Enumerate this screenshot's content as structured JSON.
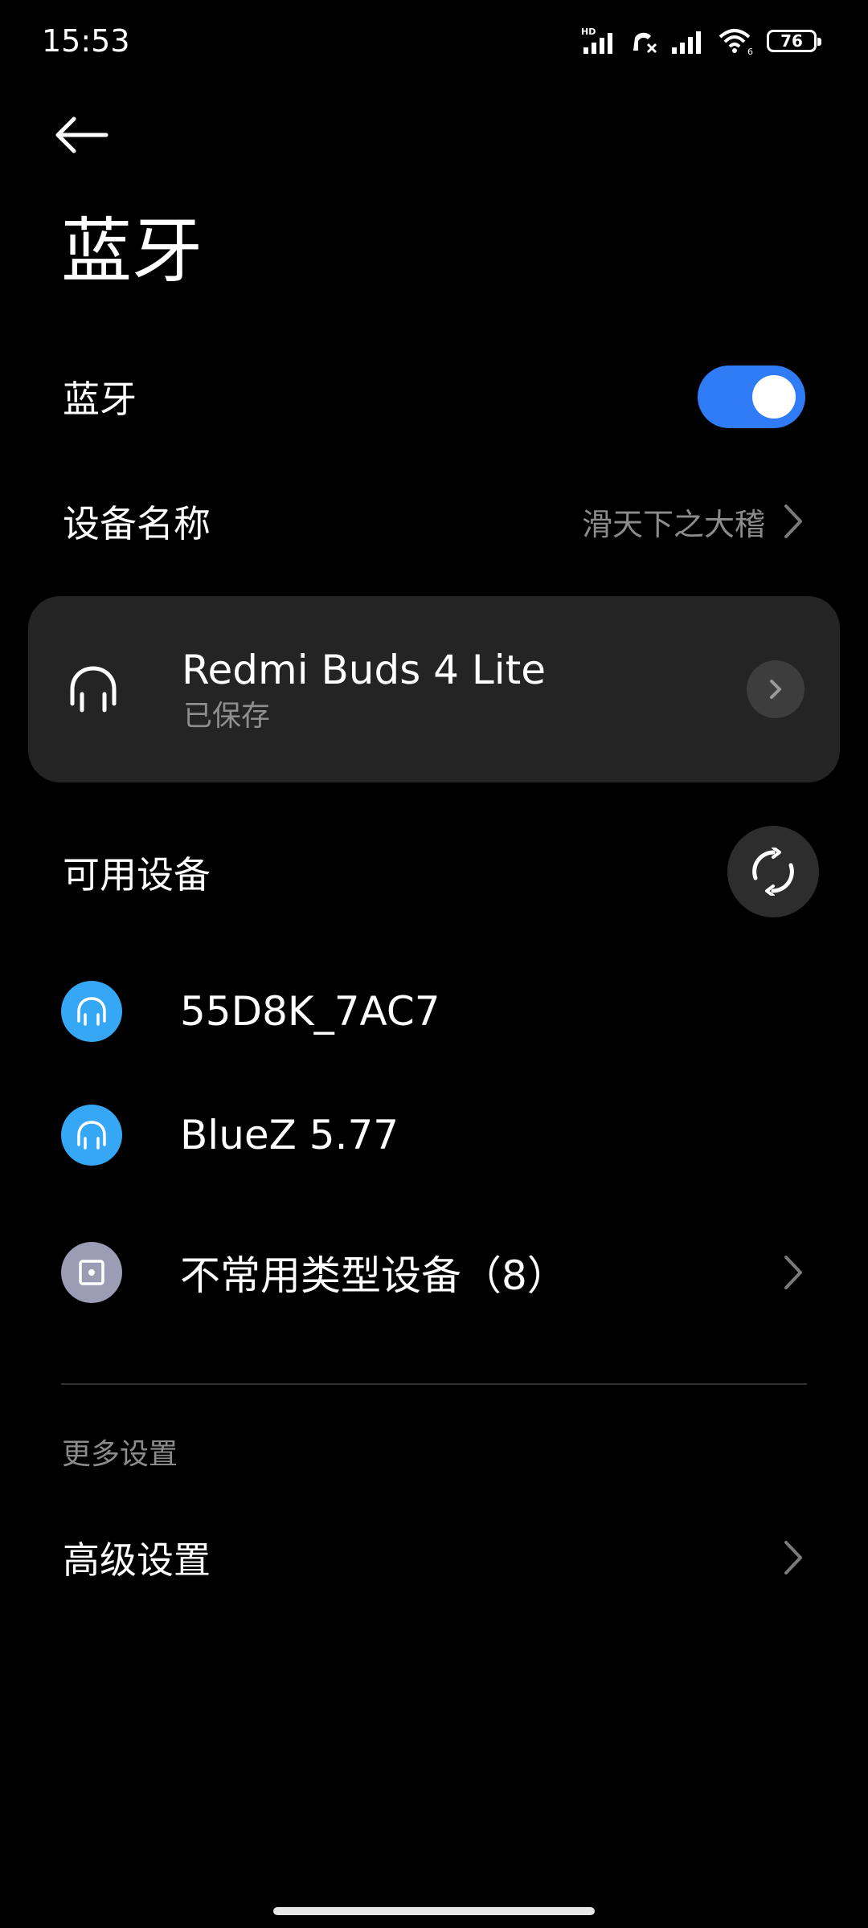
{
  "status_bar": {
    "time": "15:53",
    "hd_label": "HD",
    "wifi_label": "6",
    "battery": "76"
  },
  "header": {
    "title": "蓝牙"
  },
  "bluetooth": {
    "label": "蓝牙",
    "enabled": true,
    "accent_color": "#2f7cf6"
  },
  "device_name": {
    "label": "设备名称",
    "value": "滑天下之大稽"
  },
  "saved_device": {
    "name": "Redmi Buds 4 Lite",
    "status": "已保存",
    "icon": "headphones-icon"
  },
  "available": {
    "title": "可用设备",
    "refresh_icon": "refresh-icon",
    "devices": [
      {
        "name": "55D8K_7AC7",
        "icon": "headphones-icon",
        "color": "#36a7f5"
      },
      {
        "name": "BlueZ 5.77",
        "icon": "headphones-icon",
        "color": "#36a7f5"
      },
      {
        "name": "不常用类型设备（8）",
        "icon": "device-square-icon",
        "color": "#9c9cb4"
      }
    ]
  },
  "more": {
    "section": "更多设置",
    "advanced": "高级设置"
  }
}
